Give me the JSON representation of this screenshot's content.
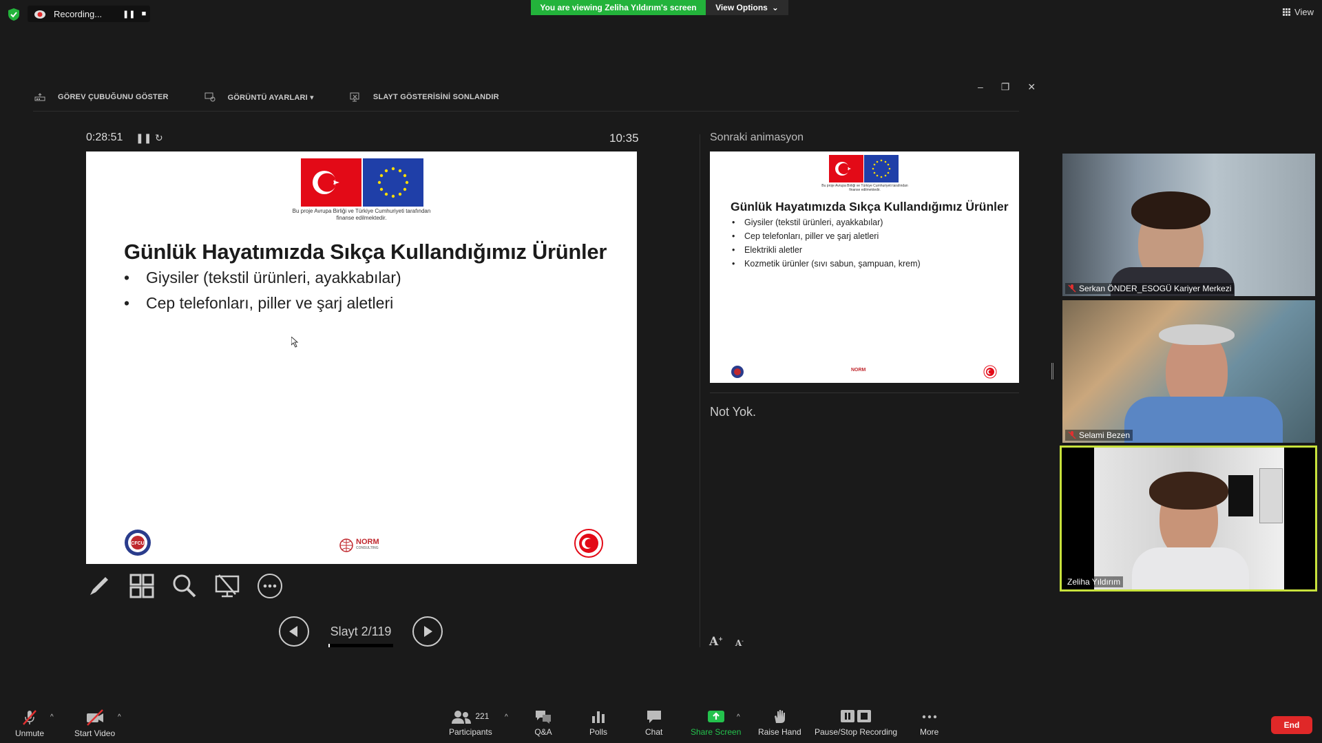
{
  "status_bar": {
    "recording_label": "Recording...",
    "viewing_banner": "You are viewing Zeliha Yıldırım's screen",
    "view_options_label": "View Options",
    "view_label": "View"
  },
  "presenter_toolbar": {
    "show_taskbar": "GÖREV ÇUBUĞUNU GÖSTER",
    "display_settings": "GÖRÜNTÜ AYARLARI ▾",
    "end_slideshow": "SLAYT GÖSTERİSİNİ SONLANDIR"
  },
  "presenter_view": {
    "elapsed_time": "0:28:51",
    "clock": "10:35",
    "slide_counter": "Slayt 2/119",
    "next_label": "Sonraki animasyon",
    "notes": "Not Yok."
  },
  "current_slide": {
    "flag_caption": "Bu proje Avrupa Birliği ve Türkiye Cumhuriyeti tarafından finanse edilmektedir.",
    "title": "Günlük Hayatımızda Sıkça Kullandığımız Ürünler",
    "bullets": [
      "Giysiler (tekstil ürünleri, ayakkabılar)",
      "Cep telefonları, piller ve şarj aletleri"
    ],
    "logo_left": "CFCU",
    "logo_middle": "NORM",
    "logo_middle_sub": "CONSULTING"
  },
  "next_slide": {
    "flag_caption": "Bu proje Avrupa Birliği ve Türkiye Cumhuriyeti tarafından finanse edilmektedir.",
    "title": "Günlük Hayatımızda Sıkça Kullandığımız Ürünler",
    "bullets": [
      "Giysiler (tekstil ürünleri, ayakkabılar)",
      "Cep telefonları, piller ve şarj aletleri",
      "Elektrikli aletler",
      "Kozmetik ürünler (sıvı sabun, şampuan, krem)"
    ],
    "logo_middle": "NORM"
  },
  "participants_videos": [
    {
      "name": "Serkan ÖNDER_ESOGÜ Kariyer Merkezi",
      "muted": true
    },
    {
      "name": "Selami Bezen",
      "muted": true
    },
    {
      "name": "Zeliha Yıldırım",
      "muted": false,
      "active_speaker": true
    }
  ],
  "bottom_toolbar": {
    "unmute": "Unmute",
    "start_video": "Start Video",
    "participants": "Participants",
    "participants_count": "221",
    "qa": "Q&A",
    "polls": "Polls",
    "chat": "Chat",
    "share_screen": "Share Screen",
    "raise_hand": "Raise Hand",
    "pause_stop_recording": "Pause/Stop Recording",
    "more": "More",
    "end": "End"
  },
  "colors": {
    "share_green": "#24c24d",
    "banner_green": "#23b33b",
    "end_red": "#e02828",
    "active_speaker_border": "#c8e23c"
  }
}
